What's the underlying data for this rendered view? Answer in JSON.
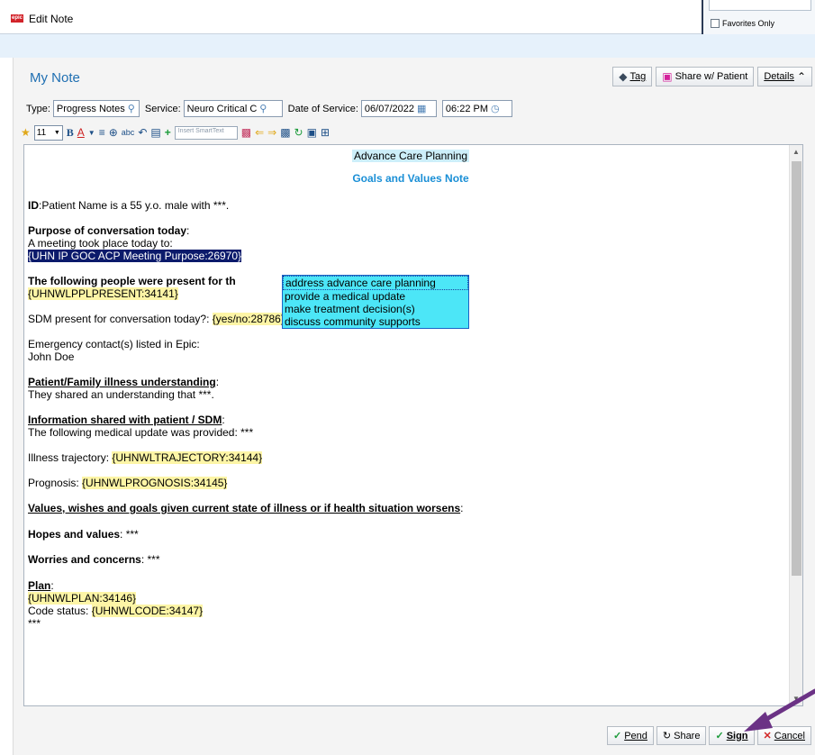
{
  "window": {
    "title": "Edit Note",
    "app_icon": "epic"
  },
  "favorites": {
    "label": "Favorites Only"
  },
  "note": {
    "title": "My Note"
  },
  "top_buttons": {
    "tag": "Tag",
    "share_patient": "Share w/ Patient",
    "details": "Details"
  },
  "fields": {
    "type_label": "Type:",
    "type_value": "Progress Notes",
    "service_label": "Service:",
    "service_value": "Neuro Critical C",
    "dos_label": "Date of Service:",
    "dos_value": "06/07/2022",
    "time_value": "06:22 PM"
  },
  "toolbar": {
    "font_size": "11",
    "smarttext_placeholder": "Insert SmartText"
  },
  "doc": {
    "heading1": "Advance Care Planning",
    "heading2": "Goals and Values Note",
    "id_label": "ID",
    "id_text": ":Patient Name is a 55 y.o. male with ***.",
    "purpose_label": "Purpose of conversation today",
    "purpose_colon": ":",
    "purpose_line": "A meeting took place today to:",
    "purpose_field": "{UHN IP GOC ACP Meeting Purpose:26970}",
    "present_label": "The following people were present for th",
    "present_field": "{UHNWLPPLPRESENT:34141}",
    "sdm_text": "SDM present for conversation today?: ",
    "sdm_field": "{yes/no:28786}",
    "emergency_line": "Emergency contact(s) listed in Epic:",
    "emergency_name": "John Doe",
    "illness_label": "Patient/Family illness understanding",
    "illness_colon": ":",
    "illness_text": "They shared an understanding that ***.",
    "info_label": "Information shared with patient / SDM",
    "info_colon": ":",
    "info_text": "The following medical update was provided: ***",
    "trajectory_text": "Illness trajectory: ",
    "trajectory_field": "{UHNWLTRAJECTORY:34144}",
    "prognosis_text": "Prognosis: ",
    "prognosis_field": "{UHNWLPROGNOSIS:34145}",
    "values_label": "Values, wishes and goals given current state of illness or if health situation worsens",
    "values_colon": ":",
    "hopes_label": "Hopes and values",
    "hopes_text": ": ***",
    "worries_label": "Worries and concerns",
    "worries_text": ": ***",
    "plan_label": "Plan",
    "plan_colon": ":",
    "plan_field": "{UHNWLPLAN:34146}",
    "code_text": "Code status: ",
    "code_field": "{UHNWLCODE:34147}",
    "stars": "***"
  },
  "popup": {
    "options": [
      "address advance care planning",
      "provide a medical update",
      "make treatment decision(s)",
      "discuss community supports"
    ]
  },
  "bottom_buttons": {
    "pend": "Pend",
    "share": "Share",
    "sign": "Sign",
    "cancel": "Cancel"
  },
  "colors": {
    "accent": "#1f6fb2",
    "heading": "#1a8fd6",
    "smartlist": "#fdf5a6",
    "popup": "#4ce6f7",
    "arrow": "#6b3285"
  }
}
